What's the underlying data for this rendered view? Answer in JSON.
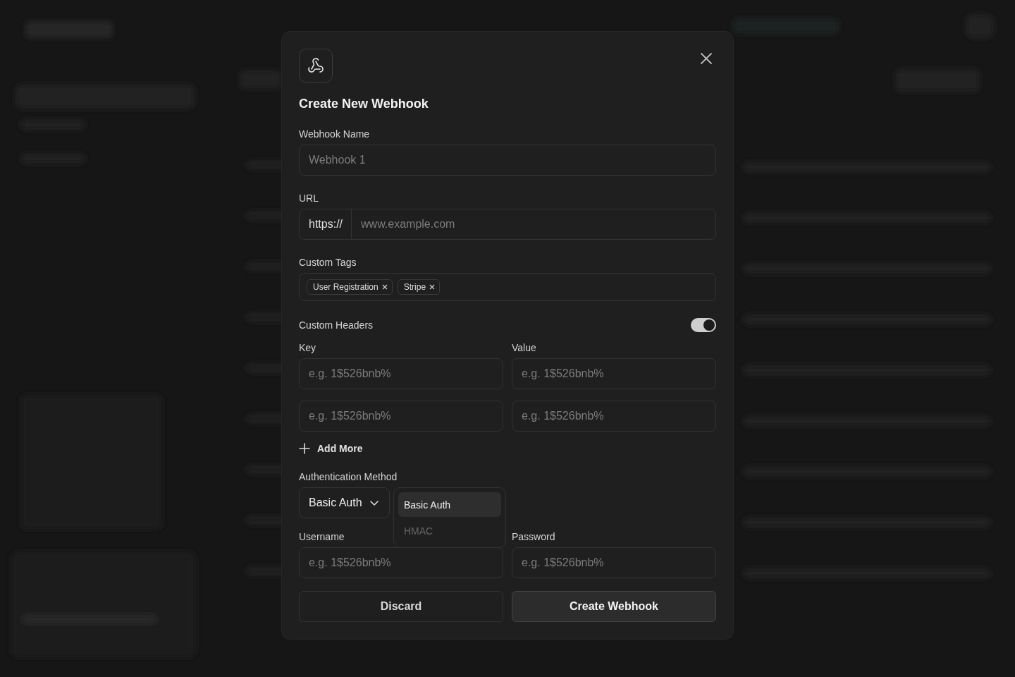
{
  "dialog": {
    "title": "Create New Webhook",
    "name_field": {
      "label": "Webhook Name",
      "placeholder": "Webhook 1"
    },
    "url_field": {
      "label": "URL",
      "prefix": "https://",
      "placeholder": "www.example.com"
    },
    "tags": {
      "label": "Custom Tags",
      "items": [
        {
          "label": "User Registration"
        },
        {
          "label": "Stripe"
        }
      ]
    },
    "headers": {
      "label": "Custom Headers",
      "on": true,
      "key_label": "Key",
      "value_label": "Value",
      "rows": [
        {
          "key_placeholder": "e.g. 1$526bnb%",
          "value_placeholder": "e.g. 1$526bnb%"
        },
        {
          "key_placeholder": "e.g. 1$526bnb%",
          "value_placeholder": "e.g. 1$526bnb%"
        }
      ],
      "add_more": "Add More"
    },
    "auth": {
      "label": "Authentication Method",
      "value": "Basic Auth",
      "expanded": true,
      "options": [
        {
          "label": "Basic Auth",
          "selected": true
        },
        {
          "label": "HMAC",
          "selected": false
        }
      ]
    },
    "username": {
      "label": "Username",
      "placeholder": "e.g. 1$526bnb%"
    },
    "password": {
      "label": "Password",
      "placeholder": "e.g. 1$526bnb%"
    },
    "buttons": [
      {
        "label": "Discard",
        "kind": "secondary"
      },
      {
        "label": "Create Webhook",
        "kind": "primary"
      }
    ]
  }
}
